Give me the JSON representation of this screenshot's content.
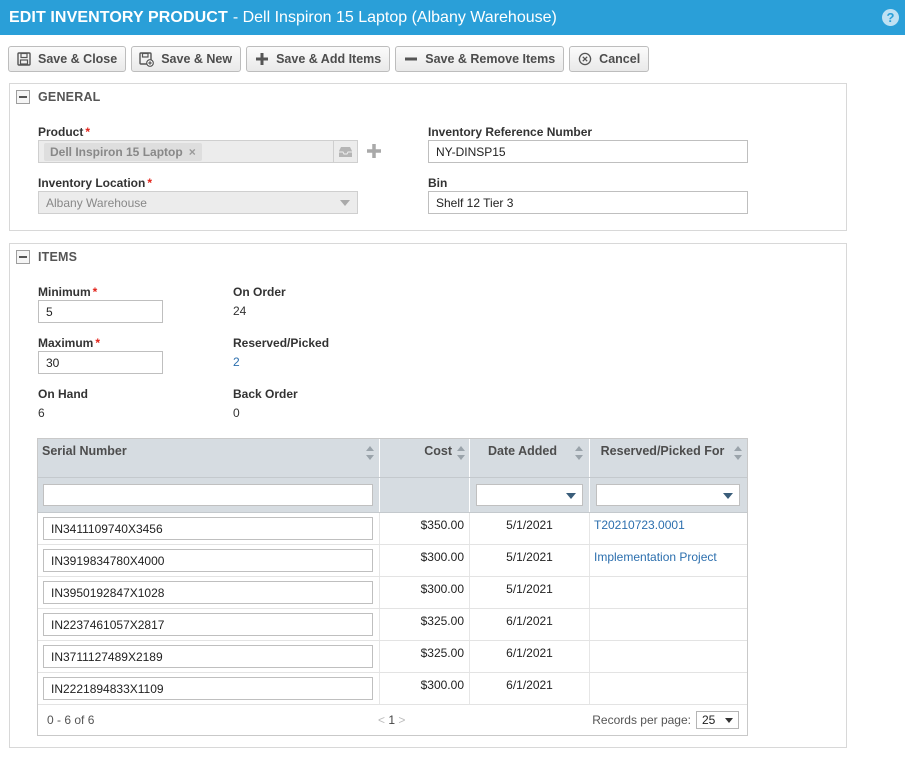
{
  "header": {
    "title_main": "EDIT INVENTORY PRODUCT",
    "title_sub": "- Dell Inspiron 15 Laptop (Albany Warehouse)",
    "help_icon": "?"
  },
  "toolbar": {
    "save_close": "Save & Close",
    "save_new": "Save & New",
    "save_add_items": "Save & Add Items",
    "save_remove_items": "Save & Remove Items",
    "cancel": "Cancel"
  },
  "general": {
    "title": "GENERAL",
    "product_label": "Product",
    "product_value": "Dell Inspiron 15 Laptop",
    "product_remove": "×",
    "add_icon": "+",
    "location_label": "Inventory Location",
    "location_value": "Albany Warehouse",
    "ref_label": "Inventory Reference Number",
    "ref_value": "NY-DINSP15",
    "bin_label": "Bin",
    "bin_value": "Shelf 12 Tier 3",
    "required_mark": "*"
  },
  "items": {
    "title": "ITEMS",
    "minimum_label": "Minimum",
    "minimum_value": "5",
    "maximum_label": "Maximum",
    "maximum_value": "30",
    "on_hand_label": "On Hand",
    "on_hand_value": "6",
    "on_order_label": "On Order",
    "on_order_value": "24",
    "reserved_label": "Reserved/Picked",
    "reserved_value": "2",
    "back_order_label": "Back Order",
    "back_order_value": "0"
  },
  "grid": {
    "columns": [
      "Serial Number",
      "Cost",
      "Date Added",
      "Reserved/Picked For"
    ],
    "rows": [
      {
        "serial": "IN3411109740X3456",
        "cost": "$350.00",
        "date": "5/1/2021",
        "reserved_for": "T20210723.0001"
      },
      {
        "serial": "IN3919834780X4000",
        "cost": "$300.00",
        "date": "5/1/2021",
        "reserved_for": "Implementation Project"
      },
      {
        "serial": "IN3950192847X1028",
        "cost": "$300.00",
        "date": "5/1/2021",
        "reserved_for": ""
      },
      {
        "serial": "IN2237461057X2817",
        "cost": "$325.00",
        "date": "6/1/2021",
        "reserved_for": ""
      },
      {
        "serial": "IN3711127489X2189",
        "cost": "$325.00",
        "date": "6/1/2021",
        "reserved_for": ""
      },
      {
        "serial": "IN2221894833X1109",
        "cost": "$300.00",
        "date": "6/1/2021",
        "reserved_for": ""
      }
    ],
    "footer": {
      "count": "0 - 6 of 6",
      "prev": "<",
      "page": "1",
      "next": ">",
      "rpp_label": "Records per page:",
      "rpp_value": "25"
    }
  }
}
